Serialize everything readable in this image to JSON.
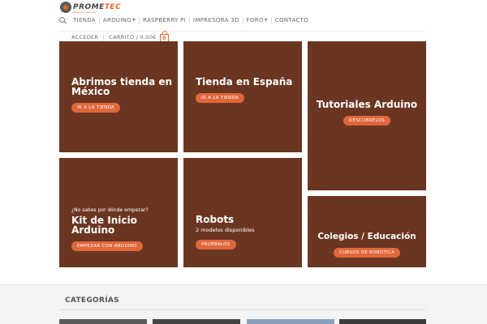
{
  "header": {
    "logo_main": "PROME",
    "logo_accent": "TEC",
    "logo_sub": "www.prometec.net",
    "nav": [
      {
        "label": "TIENDA",
        "caret": false
      },
      {
        "label": "ARDUINO",
        "caret": true
      },
      {
        "label": "RASPBERRY PI",
        "caret": false
      },
      {
        "label": "IMPRESORA 3D",
        "caret": false
      },
      {
        "label": "FORO",
        "caret": true
      },
      {
        "label": "CONTACTO",
        "caret": false
      }
    ],
    "account": {
      "login": "ACCEDER",
      "cart": "CARRITO / 0,00€",
      "cart_count": "0"
    }
  },
  "tiles": {
    "t1": {
      "title": "Abrimos tienda en México",
      "button": "IR A LA TIENDA"
    },
    "t2": {
      "title": "Tienda en España",
      "button": "IR A LA TIENDA"
    },
    "t3": {
      "title": "Tutoriales Arduino",
      "button": "DESCÚBRELOS"
    },
    "t4": {
      "kicker": "¿No sabes por dónde empezar?",
      "title": "Kit de Inicio Arduino",
      "button": "EMPEZAR CON ARDUINO"
    },
    "t5": {
      "title": "Robots",
      "subtitle": "2 modelos disponibles",
      "button": "PRUÉBALOS"
    },
    "t6": {
      "title": "Colegios / Educación",
      "button": "CURSOS DE ROBÓTICA"
    }
  },
  "categories": {
    "title": "CATEGORÍAS"
  },
  "colors": {
    "tile_bg": "#6b3621",
    "accent": "#e0673a"
  }
}
